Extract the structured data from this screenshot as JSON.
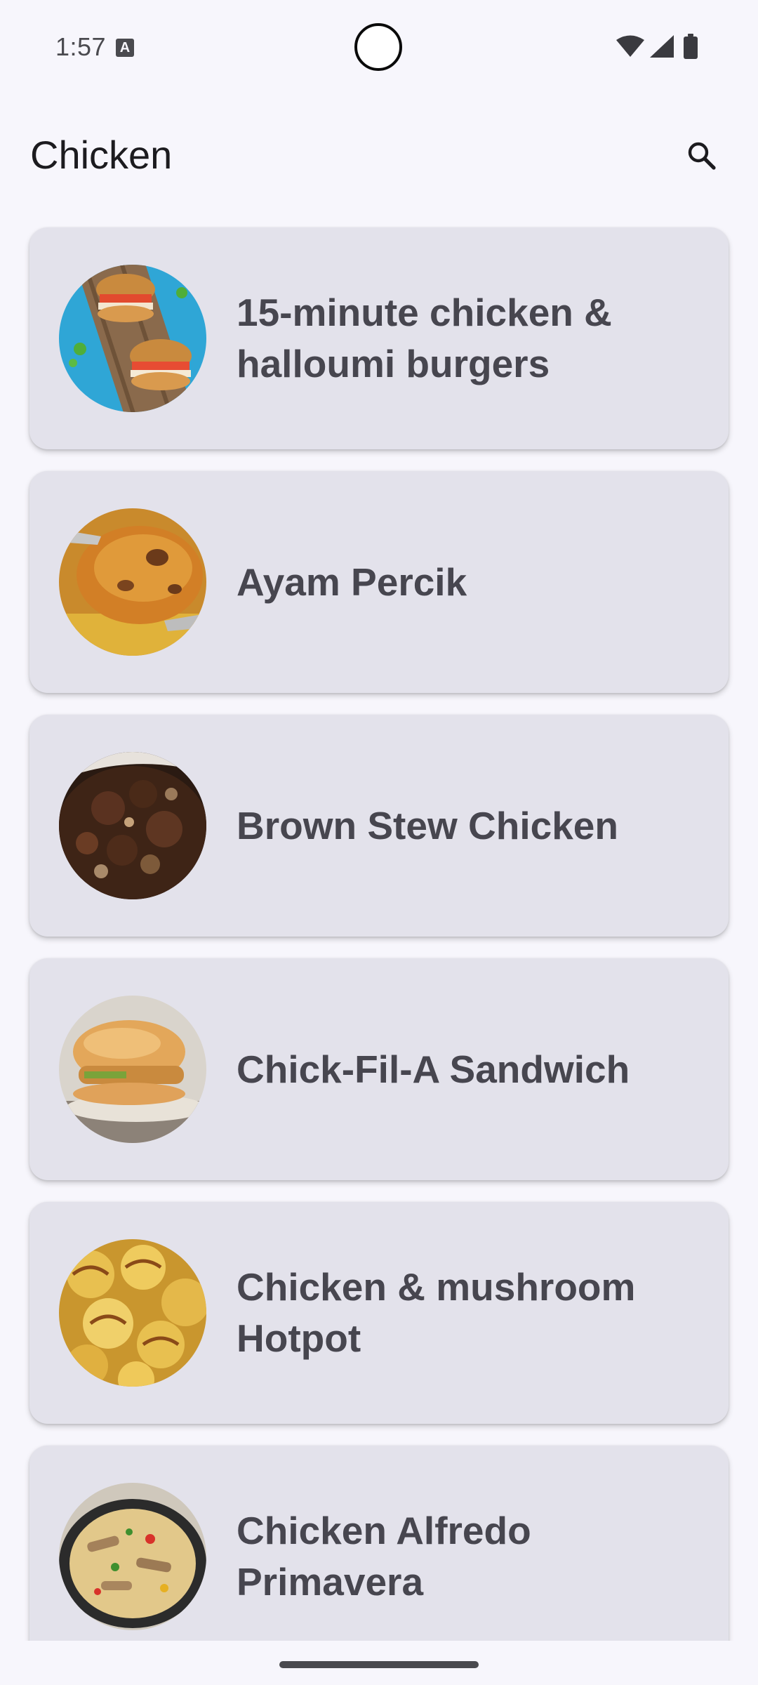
{
  "status_bar": {
    "time": "1:57",
    "notification_badge": "A",
    "icons": [
      "a-notification-icon",
      "wifi-icon",
      "signal-icon",
      "battery-icon"
    ]
  },
  "app_bar": {
    "title": "Chicken",
    "search_icon": "search-icon"
  },
  "recipes": [
    {
      "title": "15-minute chicken & halloumi burgers"
    },
    {
      "title": "Ayam Percik"
    },
    {
      "title": "Brown Stew Chicken"
    },
    {
      "title": "Chick-Fil-A Sandwich"
    },
    {
      "title": "Chicken & mushroom Hotpot"
    },
    {
      "title": "Chicken Alfredo Primavera"
    }
  ],
  "colors": {
    "background": "#f7f6fc",
    "card": "#e3e2eb",
    "title_text": "#47464f",
    "app_title": "#1c1b1f"
  }
}
